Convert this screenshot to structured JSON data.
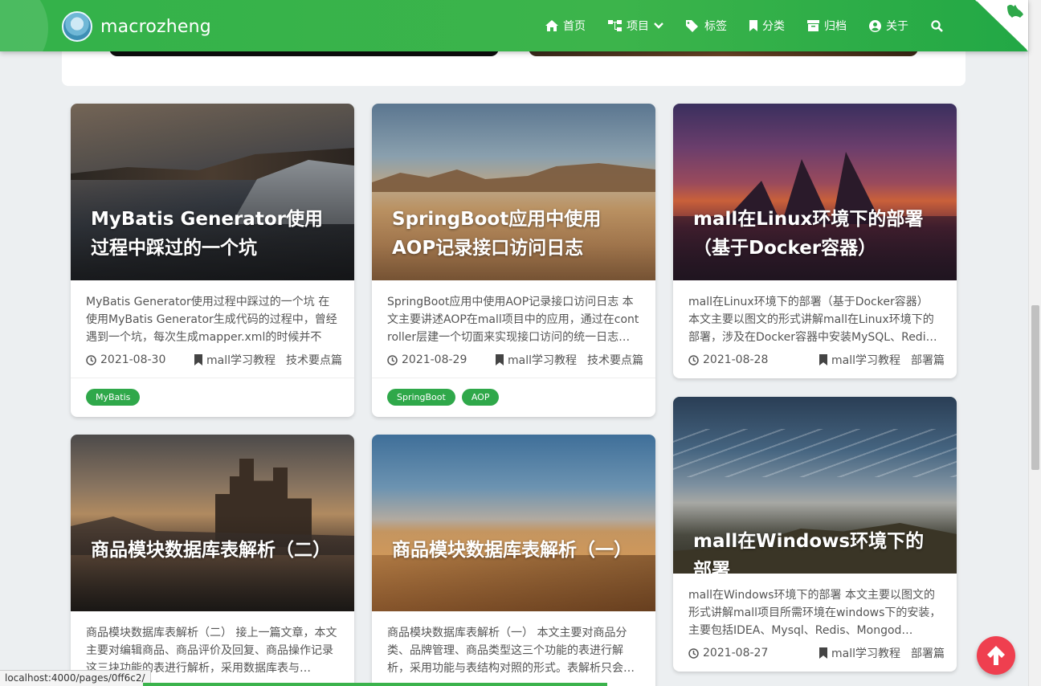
{
  "brand": {
    "name": "macrozheng"
  },
  "nav": [
    {
      "label": "首页",
      "icon": "home-icon"
    },
    {
      "label": "项目",
      "icon": "sitemap-icon",
      "dropdown": true
    },
    {
      "label": "标签",
      "icon": "tags-icon"
    },
    {
      "label": "分类",
      "icon": "bookmark-icon"
    },
    {
      "label": "归档",
      "icon": "archive-icon"
    },
    {
      "label": "关于",
      "icon": "user-circle-icon"
    }
  ],
  "cards": [
    {
      "title": "MyBatis Generator使用过程中踩过的一个坑",
      "summary": "MyBatis Generator使用过程中踩过的一个坑 在使用MyBatis Generator生成代码的过程中，曾经遇到一个坑，每次生成mapper.xml的时候并不是…",
      "date": "2021-08-30",
      "category": "mall学习教程",
      "subcategory": "技术要点篇",
      "tags": [
        "MyBatis"
      ]
    },
    {
      "title": "SpringBoot应用中使用AOP记录接口访问日志",
      "summary": "SpringBoot应用中使用AOP记录接口访问日志 本文主要讲述AOP在mall项目中的应用，通过在controller层建一个切面来实现接口访问的统一日志…",
      "date": "2021-08-29",
      "category": "mall学习教程",
      "subcategory": "技术要点篇",
      "tags": [
        "SpringBoot",
        "AOP"
      ]
    },
    {
      "title": "mall在Linux环境下的部署（基于Docker容器）",
      "summary": "mall在Linux环境下的部署（基于Docker容器） 本文主要以图文的形式讲解mall在Linux环境下的部署，涉及在Docker容器中安装MySQL、Redi…",
      "date": "2021-08-28",
      "category": "mall学习教程",
      "subcategory": "部署篇",
      "tags": []
    },
    {
      "title": "商品模块数据库表解析（二）",
      "summary": "商品模块数据库表解析（二） 接上一篇文章，本文主要对编辑商品、商品评价及回复、商品操作记录这三块功能的表进行解析，采用数据库表与…",
      "date": "",
      "category": "",
      "subcategory": "",
      "tags": []
    },
    {
      "title": "商品模块数据库表解析（一）",
      "summary": "商品模块数据库表解析（一） 本文主要对商品分类、品牌管理、商品类型这三个功能的表进行解析，采用功能与表结构对照的形式。表解析只会…",
      "date": "",
      "category": "",
      "subcategory": "",
      "tags": []
    },
    {
      "title": "mall在Windows环境下的部署",
      "summary": "mall在Windows环境下的部署 本文主要以图文的形式讲解mall项目所需环境在windows下的安装，主要包括IDEA、Mysql、Redis、Mongod…",
      "date": "2021-08-27",
      "category": "mall学习教程",
      "subcategory": "部署篇",
      "tags": []
    }
  ],
  "status_bar": {
    "url": "localhost:4000/pages/0ff6c2/"
  },
  "colors": {
    "primary": "#3cb44b",
    "back_to_top": "#ef3f4f"
  }
}
